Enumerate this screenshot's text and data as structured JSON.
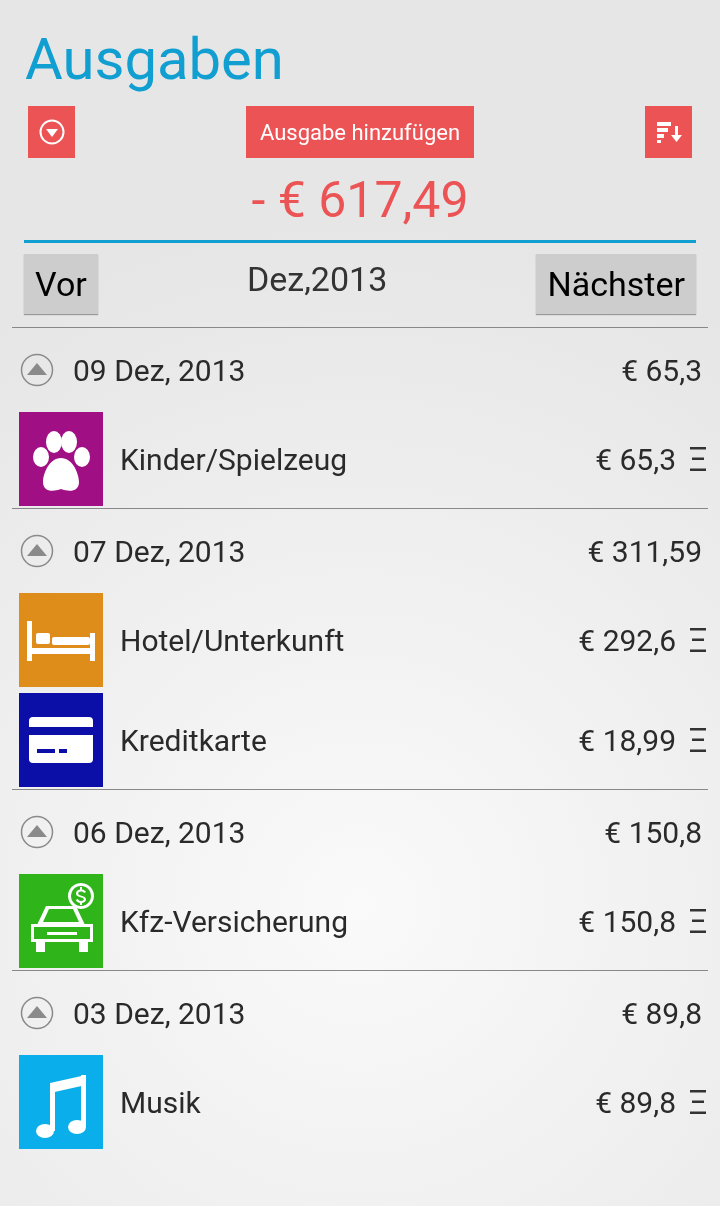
{
  "title": "Ausgaben",
  "toolbar": {
    "add_button": "Ausgabe hinzufügen"
  },
  "total": "- € 617,49",
  "nav": {
    "prev": "Vor",
    "period": "Dez,2013",
    "next": "Nächster"
  },
  "groups": [
    {
      "date": "09 Dez, 2013",
      "total": "€ 65,3",
      "expanded": true,
      "items": [
        {
          "name": "Kinder/Spielzeug",
          "amount": "€ 65,3",
          "kind": "paw",
          "color": "#a10f84"
        }
      ]
    },
    {
      "date": "07 Dez, 2013",
      "total": "€ 311,59",
      "expanded": true,
      "items": [
        {
          "name": "Hotel/Unterkunft",
          "amount": "€ 292,6",
          "kind": "bed",
          "color": "#df8d1a"
        },
        {
          "name": "Kreditkarte",
          "amount": "€ 18,99",
          "kind": "card",
          "color": "#0b0ea7"
        }
      ]
    },
    {
      "date": "06 Dez, 2013",
      "total": "€ 150,8",
      "expanded": true,
      "items": [
        {
          "name": "Kfz-Versicherung",
          "amount": "€ 150,8",
          "kind": "car",
          "color": "#2fb51a"
        }
      ]
    },
    {
      "date": "03 Dez, 2013",
      "total": "€ 89,8",
      "expanded": true,
      "items": [
        {
          "name": "Musik",
          "amount": "€ 89,8",
          "kind": "music",
          "color": "#0aaeea"
        }
      ]
    }
  ]
}
